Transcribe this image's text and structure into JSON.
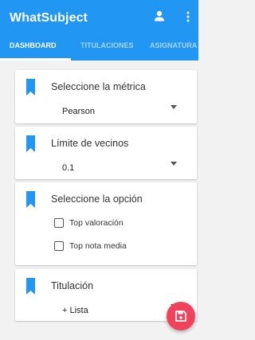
{
  "app_bar": {
    "title": "WhatSubject",
    "icons": [
      "person-icon",
      "more-vert-icon"
    ]
  },
  "tabs": [
    {
      "label": "DASHBOARD",
      "active": true
    },
    {
      "label": "TITULACIONES",
      "active": false
    },
    {
      "label": "ASIGNATURA",
      "active": false
    }
  ],
  "cards": {
    "metric": {
      "title": "Seleccione la métrica",
      "value": "Pearson"
    },
    "neighbors": {
      "title": "Límite de vecinos",
      "value": "0.1"
    },
    "option": {
      "title": "Seleccione la opción",
      "options": [
        {
          "label": "Top valoración",
          "checked": false
        },
        {
          "label": "Top nota media",
          "checked": false
        }
      ]
    },
    "degree": {
      "title": "Titulación",
      "value": "+ Lista"
    }
  },
  "fab": {
    "icon": "save-icon"
  },
  "colors": {
    "primary": "#2196f3",
    "accent": "#f0425a",
    "background": "#f2f2f2"
  }
}
